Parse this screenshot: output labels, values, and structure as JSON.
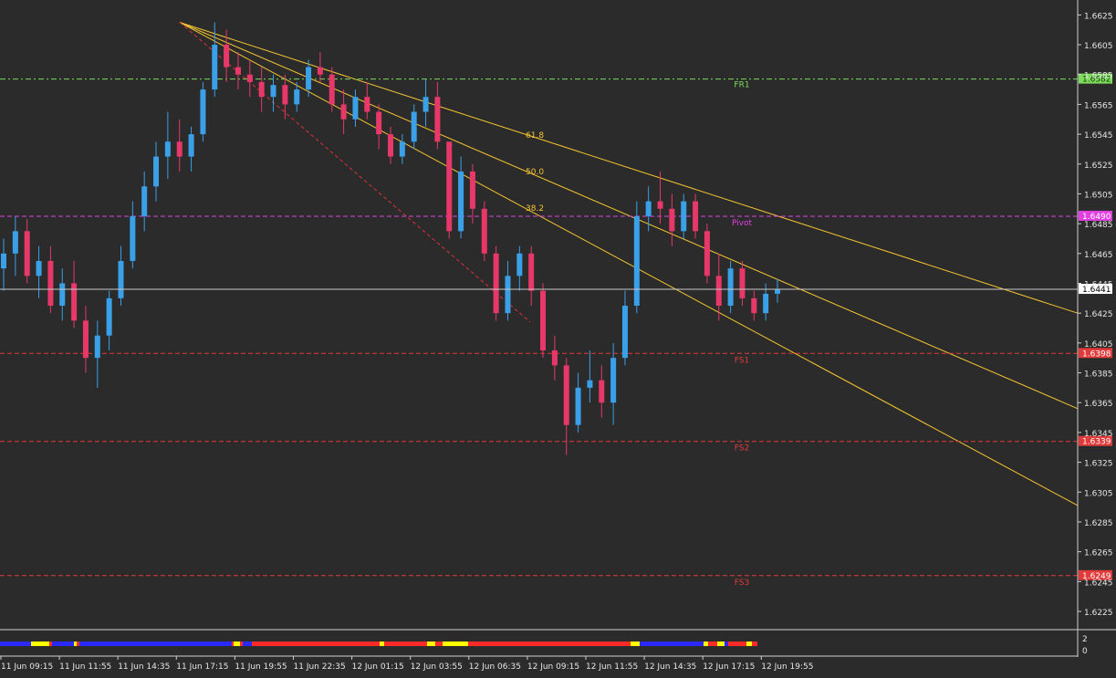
{
  "chart_data": {
    "type": "candlestick",
    "ylim": [
      1.6214,
      1.6635
    ],
    "y_ticks": [
      "1.6625",
      "1.6605",
      "1.6585",
      "1.6565",
      "1.6545",
      "1.6525",
      "1.6505",
      "1.6485",
      "1.6465",
      "1.6445",
      "1.6425",
      "1.6405",
      "1.6385",
      "1.6365",
      "1.6345",
      "1.6325",
      "1.6305",
      "1.6285",
      "1.6265",
      "1.6245",
      "1.6225"
    ],
    "x_ticks": [
      "11 Jun 09:15",
      "11 Jun 11:55",
      "11 Jun 14:35",
      "11 Jun 17:15",
      "11 Jun 19:55",
      "11 Jun 22:35",
      "12 Jun 01:15",
      "12 Jun 03:55",
      "12 Jun 06:35",
      "12 Jun 09:15",
      "12 Jun 11:55",
      "12 Jun 14:35",
      "12 Jun 17:15",
      "12 Jun 19:55"
    ],
    "current_price": "1.6441",
    "levels": [
      {
        "name": "FR1",
        "value": 1.6582,
        "label": "1.6582",
        "color": "#7ddc5a"
      },
      {
        "name": "Pivot",
        "value": 1.649,
        "label": "1.6490",
        "color": "#e040e0"
      },
      {
        "name": "FS1",
        "value": 1.6398,
        "label": "1.6398",
        "color": "#e03a3a"
      },
      {
        "name": "FS2",
        "value": 1.6339,
        "label": "1.6339",
        "color": "#e03a3a"
      },
      {
        "name": "FS3",
        "value": 1.6249,
        "label": "1.6249",
        "color": "#e03a3a"
      }
    ],
    "fan_labels": [
      "61.8",
      "50.0",
      "38.2"
    ],
    "series": [
      {
        "time_index": 0,
        "open": 1.6455,
        "high": 1.6475,
        "low": 1.644,
        "close": 1.6465
      },
      {
        "time_index": 1,
        "open": 1.6465,
        "high": 1.649,
        "low": 1.645,
        "close": 1.648
      },
      {
        "time_index": 2,
        "open": 1.648,
        "high": 1.6488,
        "low": 1.6445,
        "close": 1.645
      },
      {
        "time_index": 3,
        "open": 1.645,
        "high": 1.647,
        "low": 1.6435,
        "close": 1.646
      },
      {
        "time_index": 4,
        "open": 1.646,
        "high": 1.647,
        "low": 1.6425,
        "close": 1.643
      },
      {
        "time_index": 5,
        "open": 1.643,
        "high": 1.6455,
        "low": 1.642,
        "close": 1.6445
      },
      {
        "time_index": 6,
        "open": 1.6445,
        "high": 1.646,
        "low": 1.6415,
        "close": 1.642
      },
      {
        "time_index": 7,
        "open": 1.642,
        "high": 1.643,
        "low": 1.6385,
        "close": 1.6395
      },
      {
        "time_index": 8,
        "open": 1.6395,
        "high": 1.642,
        "low": 1.6375,
        "close": 1.641
      },
      {
        "time_index": 9,
        "open": 1.641,
        "high": 1.644,
        "low": 1.64,
        "close": 1.6435
      },
      {
        "time_index": 10,
        "open": 1.6435,
        "high": 1.647,
        "low": 1.643,
        "close": 1.646
      },
      {
        "time_index": 11,
        "open": 1.646,
        "high": 1.65,
        "low": 1.6455,
        "close": 1.649
      },
      {
        "time_index": 12,
        "open": 1.649,
        "high": 1.652,
        "low": 1.648,
        "close": 1.651
      },
      {
        "time_index": 13,
        "open": 1.651,
        "high": 1.654,
        "low": 1.65,
        "close": 1.653
      },
      {
        "time_index": 14,
        "open": 1.653,
        "high": 1.656,
        "low": 1.6515,
        "close": 1.654
      },
      {
        "time_index": 15,
        "open": 1.654,
        "high": 1.6555,
        "low": 1.652,
        "close": 1.653
      },
      {
        "time_index": 16,
        "open": 1.653,
        "high": 1.655,
        "low": 1.652,
        "close": 1.6545
      },
      {
        "time_index": 17,
        "open": 1.6545,
        "high": 1.658,
        "low": 1.654,
        "close": 1.6575
      },
      {
        "time_index": 18,
        "open": 1.6575,
        "high": 1.662,
        "low": 1.657,
        "close": 1.6605
      },
      {
        "time_index": 19,
        "open": 1.6605,
        "high": 1.6615,
        "low": 1.658,
        "close": 1.659
      },
      {
        "time_index": 20,
        "open": 1.659,
        "high": 1.66,
        "low": 1.6575,
        "close": 1.6585
      },
      {
        "time_index": 21,
        "open": 1.6585,
        "high": 1.6595,
        "low": 1.657,
        "close": 1.658
      },
      {
        "time_index": 22,
        "open": 1.658,
        "high": 1.659,
        "low": 1.656,
        "close": 1.657
      },
      {
        "time_index": 23,
        "open": 1.657,
        "high": 1.6585,
        "low": 1.656,
        "close": 1.6578
      },
      {
        "time_index": 24,
        "open": 1.6578,
        "high": 1.6585,
        "low": 1.6555,
        "close": 1.6565
      },
      {
        "time_index": 25,
        "open": 1.6565,
        "high": 1.658,
        "low": 1.656,
        "close": 1.6575
      },
      {
        "time_index": 26,
        "open": 1.6575,
        "high": 1.6595,
        "low": 1.657,
        "close": 1.659
      },
      {
        "time_index": 27,
        "open": 1.659,
        "high": 1.66,
        "low": 1.658,
        "close": 1.6585
      },
      {
        "time_index": 28,
        "open": 1.6585,
        "high": 1.659,
        "low": 1.656,
        "close": 1.6565
      },
      {
        "time_index": 29,
        "open": 1.6565,
        "high": 1.6575,
        "low": 1.6545,
        "close": 1.6555
      },
      {
        "time_index": 30,
        "open": 1.6555,
        "high": 1.6575,
        "low": 1.655,
        "close": 1.657
      },
      {
        "time_index": 31,
        "open": 1.657,
        "high": 1.658,
        "low": 1.6555,
        "close": 1.656
      },
      {
        "time_index": 32,
        "open": 1.656,
        "high": 1.6565,
        "low": 1.6535,
        "close": 1.6545
      },
      {
        "time_index": 33,
        "open": 1.6545,
        "high": 1.655,
        "low": 1.6525,
        "close": 1.653
      },
      {
        "time_index": 34,
        "open": 1.653,
        "high": 1.6545,
        "low": 1.6525,
        "close": 1.654
      },
      {
        "time_index": 35,
        "open": 1.654,
        "high": 1.6565,
        "low": 1.6535,
        "close": 1.656
      },
      {
        "time_index": 36,
        "open": 1.656,
        "high": 1.6582,
        "low": 1.655,
        "close": 1.657
      },
      {
        "time_index": 37,
        "open": 1.657,
        "high": 1.658,
        "low": 1.6535,
        "close": 1.654
      },
      {
        "time_index": 38,
        "open": 1.654,
        "high": 1.651,
        "low": 1.6475,
        "close": 1.648
      },
      {
        "time_index": 39,
        "open": 1.648,
        "high": 1.653,
        "low": 1.6475,
        "close": 1.652
      },
      {
        "time_index": 40,
        "open": 1.652,
        "high": 1.6525,
        "low": 1.6485,
        "close": 1.6495
      },
      {
        "time_index": 41,
        "open": 1.6495,
        "high": 1.65,
        "low": 1.646,
        "close": 1.6465
      },
      {
        "time_index": 42,
        "open": 1.6465,
        "high": 1.647,
        "low": 1.642,
        "close": 1.6425
      },
      {
        "time_index": 43,
        "open": 1.6425,
        "high": 1.646,
        "low": 1.642,
        "close": 1.645
      },
      {
        "time_index": 44,
        "open": 1.645,
        "high": 1.647,
        "low": 1.644,
        "close": 1.6465
      },
      {
        "time_index": 45,
        "open": 1.6465,
        "high": 1.647,
        "low": 1.643,
        "close": 1.644
      },
      {
        "time_index": 46,
        "open": 1.644,
        "high": 1.6445,
        "low": 1.6395,
        "close": 1.64
      },
      {
        "time_index": 47,
        "open": 1.64,
        "high": 1.641,
        "low": 1.638,
        "close": 1.639
      },
      {
        "time_index": 48,
        "open": 1.639,
        "high": 1.6395,
        "low": 1.633,
        "close": 1.635
      },
      {
        "time_index": 49,
        "open": 1.635,
        "high": 1.6385,
        "low": 1.6345,
        "close": 1.6375
      },
      {
        "time_index": 50,
        "open": 1.6375,
        "high": 1.64,
        "low": 1.6365,
        "close": 1.638
      },
      {
        "time_index": 51,
        "open": 1.638,
        "high": 1.639,
        "low": 1.6355,
        "close": 1.6365
      },
      {
        "time_index": 52,
        "open": 1.6365,
        "high": 1.6405,
        "low": 1.635,
        "close": 1.6395
      },
      {
        "time_index": 53,
        "open": 1.6395,
        "high": 1.644,
        "low": 1.639,
        "close": 1.643
      },
      {
        "time_index": 54,
        "open": 1.643,
        "high": 1.65,
        "low": 1.6425,
        "close": 1.649
      },
      {
        "time_index": 55,
        "open": 1.649,
        "high": 1.651,
        "low": 1.648,
        "close": 1.65
      },
      {
        "time_index": 56,
        "open": 1.65,
        "high": 1.652,
        "low": 1.6485,
        "close": 1.6495
      },
      {
        "time_index": 57,
        "open": 1.6495,
        "high": 1.6505,
        "low": 1.647,
        "close": 1.648
      },
      {
        "time_index": 58,
        "open": 1.648,
        "high": 1.6505,
        "low": 1.6475,
        "close": 1.65
      },
      {
        "time_index": 59,
        "open": 1.65,
        "high": 1.6505,
        "low": 1.6475,
        "close": 1.648
      },
      {
        "time_index": 60,
        "open": 1.648,
        "high": 1.6485,
        "low": 1.6445,
        "close": 1.645
      },
      {
        "time_index": 61,
        "open": 1.645,
        "high": 1.6465,
        "low": 1.642,
        "close": 1.643
      },
      {
        "time_index": 62,
        "open": 1.643,
        "high": 1.646,
        "low": 1.6425,
        "close": 1.6455
      },
      {
        "time_index": 63,
        "open": 1.6455,
        "high": 1.646,
        "low": 1.643,
        "close": 1.6435
      },
      {
        "time_index": 64,
        "open": 1.6435,
        "high": 1.644,
        "low": 1.642,
        "close": 1.6425
      },
      {
        "time_index": 65,
        "open": 1.6425,
        "high": 1.6445,
        "low": 1.642,
        "close": 1.6438
      },
      {
        "time_index": 66,
        "open": 1.6438,
        "high": 1.6448,
        "low": 1.6432,
        "close": 1.6441
      }
    ]
  }
}
